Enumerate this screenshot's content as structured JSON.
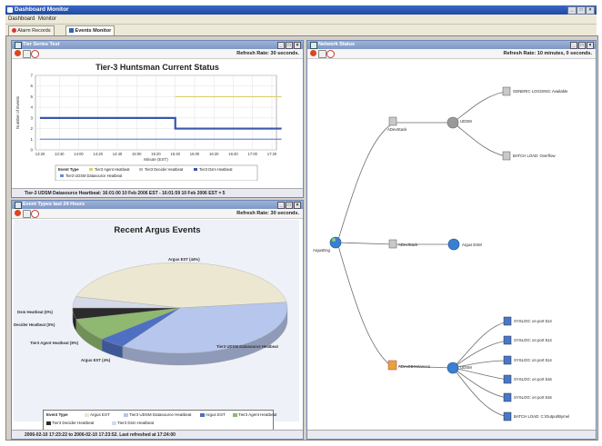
{
  "window": {
    "title": "Dashboard Monitor",
    "min": "_",
    "max": "□",
    "close": "×"
  },
  "menu": [
    "Dashboard",
    "Monitor"
  ],
  "tabs": [
    {
      "label": "Alarm Records"
    },
    {
      "label": "Events Monitor"
    }
  ],
  "status_pane": {
    "title": "Tier Series Test",
    "refresh": "Refresh Rate: 30 seconds.",
    "chart_title": "Tier-3 Huntsman Current Status",
    "status_text": "Tier-3 UDSM Datasource Heartbeat: 16:01:00 10 Feb 2006 EST - 16:01:59 10 Feb 2006 EST = 5"
  },
  "pie_pane": {
    "title": "Event Types last 24 Hours",
    "refresh": "Refresh Rate: 30 seconds.",
    "chart_title": "Recent Argus Events",
    "status_text": "2006-02-10 17:23:22 to 2006-02-10 17:23:52. Last refreshed at 17:24:00"
  },
  "network_pane": {
    "title": "Network Status",
    "refresh": "Refresh Rate: 10 minutes, 0 seconds.",
    "nodes": {
      "root": "ArgusEng",
      "hub1": "ADevStack",
      "gray_hub": "UDSM",
      "top_leaf1": "GENERIC LOGGING: Available",
      "top_leaf2": "BATCH LOAD: Overflow",
      "hub2": "ADevStack",
      "globe": "Argus ESM",
      "hub3": "ADevDBInstance1",
      "hub3_right": "UDSM",
      "leaves": [
        "SYSLOG: on port 514",
        "SYSLOG: on port 514",
        "SYSLOG: on port 514",
        "SYSLOG: on port 516",
        "SYSLOG: on port 516",
        "BATCH LOAD: C:\\Output\\Bymel"
      ]
    }
  },
  "chart_data": [
    {
      "type": "line",
      "title": "Tier-3 Huntsman Current Status",
      "xlabel": "Minute (EST)",
      "ylabel": "Number of Events",
      "x": [
        "13:20",
        "13:40",
        "14:00",
        "14:20",
        "14:40",
        "15:00",
        "15:20",
        "15:40",
        "16:00",
        "16:20",
        "16:40",
        "17:00",
        "17:20"
      ],
      "ylim": [
        0,
        7
      ],
      "yticks": [
        0,
        1,
        2,
        3,
        4,
        5,
        6,
        7
      ],
      "grid": true,
      "legend_title": "Event Type",
      "legend": [
        "Tier3 Agent Heatbeat",
        "Tier3 Decider Heatbeat",
        "Tier3 Dsm Heatbeat",
        "Tier3 UDSM Datasource Heatbeat"
      ],
      "series": [
        {
          "name": "Tier3 Agent Heatbeat",
          "color": "#d8d06a",
          "points": [
            [
              7,
              5
            ],
            [
              12.5,
              5
            ]
          ]
        },
        {
          "name": "Tier3 Dsm Heatbeat",
          "color": "#3a56a8",
          "points": [
            [
              0,
              3
            ],
            [
              7,
              3
            ],
            [
              7,
              2
            ],
            [
              12.5,
              2
            ]
          ]
        },
        {
          "name": "Tier3 UDSM Datasource Heatbeat",
          "color": "#6a8ad8",
          "points": [
            [
              0,
              1
            ],
            [
              12.5,
              1
            ]
          ]
        }
      ]
    },
    {
      "type": "pie",
      "title": "Recent Argus Events",
      "legend_title": "Event Type",
      "slices": [
        {
          "label": "Argus EST (44%)",
          "name": "Argus EST",
          "value": 44,
          "color": "#ece7d0"
        },
        {
          "label": "Tier3 UDSM Datasource Heatbeat",
          "name": "Tier3 UDSM Datasource Heatbeat",
          "value": 36,
          "color": "#b7c6ec"
        },
        {
          "label": "Argus EST (4%)",
          "name": "Argus EST",
          "value": 4,
          "color": "#4f6fc2"
        },
        {
          "label": "Tier3 Agent Heatbeat (8%)",
          "name": "Tier3 Agent Heatbeat",
          "value": 8,
          "color": "#8fb870"
        },
        {
          "label": "Decider Heatbeat (0%)",
          "name": "Tier3 Decider Heatbeat",
          "value": 4,
          "color": "#2b2b2b"
        },
        {
          "label": "Dsm Heatbeat (0%)",
          "name": "Tier3 Dsm Heatbeat",
          "value": 4,
          "color": "#d6d9e8"
        }
      ],
      "legend": [
        "Argus EST",
        "Tier3 UDSM Datasource Heatbeat",
        "Argus EST",
        "Tier3 Agent Heatbeat",
        "Tier3 Decider Heatbeat",
        "Tier3 Dsm Heatbeat"
      ]
    }
  ]
}
